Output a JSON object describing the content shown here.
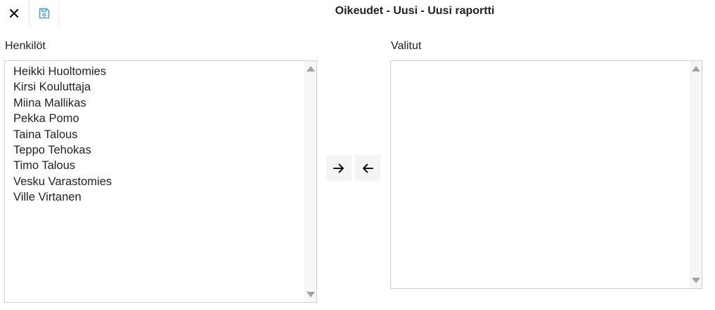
{
  "header": {
    "title": "Oikeudet - Uusi - Uusi raportti",
    "close_icon": "close-icon",
    "save_icon": "save-icon"
  },
  "left_list": {
    "label": "Henkilöt",
    "items": [
      "Heikki Huoltomies",
      "Kirsi Kouluttaja",
      "Miina Mallikas",
      "Pekka Pomo",
      "Taina Talous",
      "Teppo Tehokas",
      "Timo Talous",
      "Vesku Varastomies",
      "Ville Virtanen"
    ]
  },
  "right_list": {
    "label": "Valitut",
    "items": []
  },
  "transfer": {
    "add_icon": "arrow-right-icon",
    "remove_icon": "arrow-left-icon"
  },
  "colors": {
    "save_icon": "#4aa3c7",
    "border": "#cfcfcf",
    "button_bg": "#f4f4f4"
  }
}
